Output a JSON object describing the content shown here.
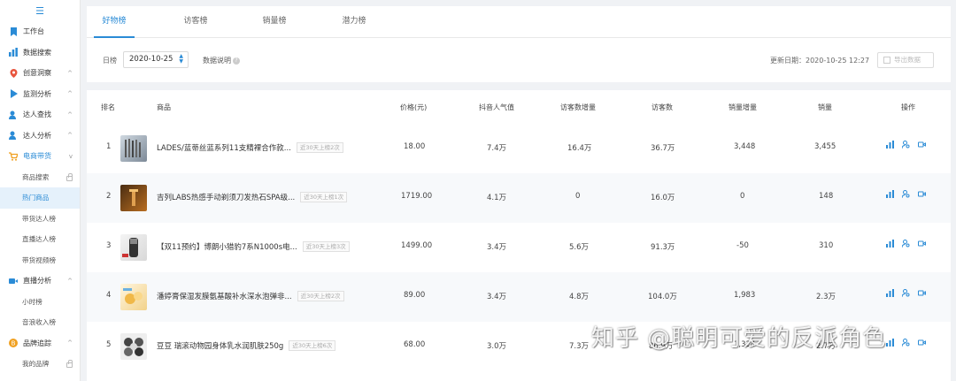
{
  "sidebar": {
    "menu_icon": "hamburger-icon",
    "items": [
      {
        "label": "工作台",
        "icon": "bookmark-icon",
        "chevron": ""
      },
      {
        "label": "数据搜索",
        "icon": "bar-chart-icon",
        "chevron": ""
      },
      {
        "label": "创意洞察",
        "icon": "location-pin-icon",
        "chevron": "^"
      },
      {
        "label": "监测分析",
        "icon": "play-icon",
        "chevron": "^"
      },
      {
        "label": "达人查找",
        "icon": "user-icon",
        "chevron": "^"
      },
      {
        "label": "达人分析",
        "icon": "user-icon",
        "chevron": "^"
      },
      {
        "label": "电商带货",
        "icon": "cart-icon",
        "chevron": "v"
      }
    ],
    "ecommerce_sub": [
      {
        "label": "商品搜索"
      },
      {
        "label": "热门商品"
      },
      {
        "label": "带货达人榜"
      },
      {
        "label": "直播达人榜"
      },
      {
        "label": "带货视频榜"
      }
    ],
    "live_section": {
      "label": "直播分析",
      "icon": "video-icon",
      "chevron": "^"
    },
    "live_sub": [
      {
        "label": "小时榜"
      },
      {
        "label": "音浪收入榜"
      }
    ],
    "brand_section": {
      "label": "品牌追踪",
      "icon": "brand-icon",
      "chevron": "^"
    },
    "brand_sub": [
      {
        "label": "我的品牌"
      }
    ]
  },
  "tabs": [
    {
      "label": "好物榜"
    },
    {
      "label": "访客榜"
    },
    {
      "label": "销量榜"
    },
    {
      "label": "潜力榜"
    }
  ],
  "filter": {
    "date_label": "日榜",
    "date_value": "2020-10-25",
    "explain_label": "数据说明",
    "update_text": "更新日期：2020-10-25 12:27",
    "export_label": "导出数据"
  },
  "table": {
    "headers": {
      "rank": "排名",
      "product": "商品",
      "price": "价格(元)",
      "popularity": "抖音人气值",
      "visitor_inc": "访客数增量",
      "visitors": "访客数",
      "sales_inc": "销量增量",
      "sales": "销量",
      "ops": "操作"
    },
    "rows": [
      {
        "rank": "1",
        "name": "LADES/蓝蒂丝蓝系列11支精裸合作款...",
        "tag": "近30天上榜2次",
        "price": "18.00",
        "popularity": "7.4万",
        "visitor_inc": "16.4万",
        "visitors": "36.7万",
        "sales_inc": "3,448",
        "sales": "3,455"
      },
      {
        "rank": "2",
        "name": "吉列LABS热感手动剃须刀发热石SPA级...",
        "tag": "近30天上榜1次",
        "price": "1719.00",
        "popularity": "4.1万",
        "visitor_inc": "0",
        "visitors": "16.0万",
        "sales_inc": "0",
        "sales": "148"
      },
      {
        "rank": "3",
        "name": "【双11预约】博朗小猎豹7系N1000s电...",
        "tag": "近30天上榜3次",
        "price": "1499.00",
        "popularity": "3.4万",
        "visitor_inc": "5.6万",
        "visitors": "91.3万",
        "sales_inc": "-50",
        "sales": "310"
      },
      {
        "rank": "4",
        "name": "潘婷膏保湿发膜氨基酸补水深水泡弹非...",
        "tag": "近30天上榜2次",
        "price": "89.00",
        "popularity": "3.4万",
        "visitor_inc": "4.8万",
        "visitors": "104.0万",
        "sales_inc": "1,983",
        "sales": "2.3万"
      },
      {
        "rank": "5",
        "name": "豆豆 瑞滚动物园身体乳水润肌肤250g",
        "tag": "近30天上榜6次",
        "price": "68.00",
        "popularity": "3.0万",
        "visitor_inc": "7.3万",
        "visitors": "86.9万",
        "sales_inc": "1,324",
        "sales": "2.7万"
      }
    ]
  },
  "watermark": "知乎 @聪明可爱的反派角色",
  "colors": {
    "accent": "#2a8bd6",
    "active_bg": "#e5f1fb"
  }
}
